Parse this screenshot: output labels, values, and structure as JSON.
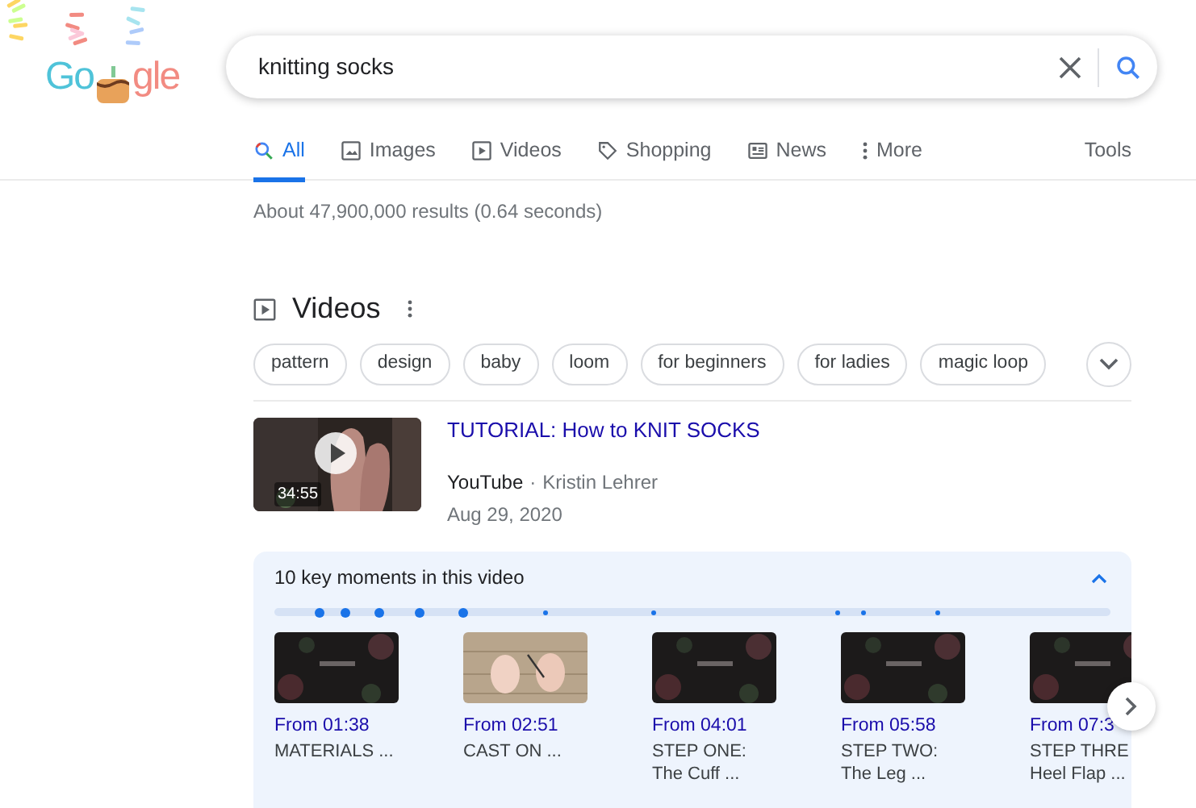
{
  "logo": {
    "left": "Go",
    "right": "gle"
  },
  "search": {
    "value": "knitting socks"
  },
  "tabs": [
    {
      "label": "All",
      "selected": true
    },
    {
      "label": "Images",
      "selected": false
    },
    {
      "label": "Videos",
      "selected": false
    },
    {
      "label": "Shopping",
      "selected": false
    },
    {
      "label": "News",
      "selected": false
    },
    {
      "label": "More",
      "selected": false
    }
  ],
  "tools": "Tools",
  "result_stats": "About 47,900,000 results (0.64 seconds)",
  "videos_section": {
    "title": "Videos",
    "chips": [
      "pattern",
      "design",
      "baby",
      "loom",
      "for beginners",
      "for ladies",
      "magic loop"
    ],
    "video": {
      "title": "TUTORIAL: How to KNIT SOCKS",
      "source": "YouTube",
      "separator": "·",
      "author": "Kristin Lehrer",
      "date": "Aug 29, 2020",
      "duration": "34:55"
    },
    "key_moments": {
      "title": "10 key moments in this video",
      "expanded": true,
      "markers": [
        {
          "level": 0.054,
          "highlighted": true
        },
        {
          "level": 0.085,
          "highlighted": true
        },
        {
          "level": 0.125,
          "highlighted": true
        },
        {
          "level": 0.174,
          "highlighted": true
        },
        {
          "level": 0.226,
          "highlighted": true
        },
        {
          "level": 0.324,
          "highlighted": false
        },
        {
          "level": 0.454,
          "highlighted": false
        },
        {
          "level": 0.674,
          "highlighted": false
        },
        {
          "level": 0.705,
          "highlighted": false
        },
        {
          "level": 0.793,
          "highlighted": false
        }
      ],
      "moments": [
        {
          "time": "From 01:38",
          "label": "MATERIALS ...",
          "kind": "dark"
        },
        {
          "time": "From 02:51",
          "label": "CAST ON ...",
          "kind": "wood"
        },
        {
          "time": "From 04:01",
          "label": "STEP ONE: The Cuff ...",
          "kind": "dark"
        },
        {
          "time": "From 05:58",
          "label": "STEP TWO: The Leg ...",
          "kind": "dark"
        },
        {
          "time": "From 07:3",
          "label": "STEP THRE Heel Flap ...",
          "kind": "dark"
        }
      ]
    }
  }
}
